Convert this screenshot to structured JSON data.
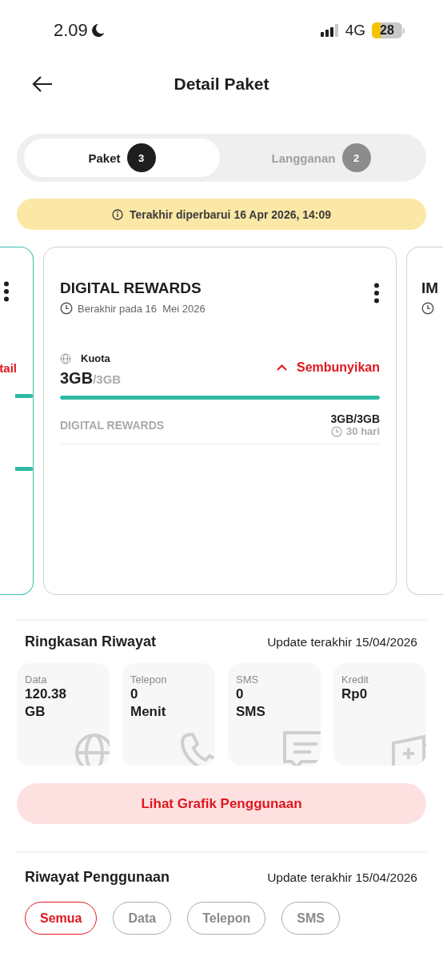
{
  "status_bar": {
    "time": "2.09",
    "network": "4G",
    "battery": "28"
  },
  "header": {
    "title": "Detail Paket"
  },
  "tabs": [
    {
      "label": "Paket",
      "count": "3",
      "selected": true
    },
    {
      "label": "Langganan",
      "count": "2",
      "selected": false
    }
  ],
  "notice": {
    "text": "Terakhir diperbarui 16 Apr 2026, 14:09"
  },
  "carousel": {
    "prev_card": {
      "action": "tail",
      "bars": [
        {
          "level": 1
        },
        {
          "level": 1
        }
      ]
    },
    "card": {
      "title": "DIGITAL REWARDS",
      "expiry": "Berakhir pada 16  Mei 2026",
      "quota_label": "Kuota",
      "used": "3GB",
      "total": "/3GB",
      "toggle": "Sembunyikan",
      "expanded": true,
      "level": 1,
      "items": [
        {
          "name": "DIGITAL REWARDS",
          "amount": "3GB/3GB",
          "duration": "30 hari"
        }
      ]
    },
    "next_card": {
      "title": "IM"
    }
  },
  "summary": {
    "title": "Ringkasan Riwayat",
    "updated": "Update terakhir 15/04/2026",
    "tiles": [
      {
        "kind": "data",
        "label": "Data",
        "value": "120.38\nGB"
      },
      {
        "kind": "call",
        "label": "Telepon",
        "value": "0\nMenit"
      },
      {
        "kind": "sms",
        "label": "SMS",
        "value": "0\nSMS"
      },
      {
        "kind": "credit",
        "label": "Kredit",
        "value": "Rp0"
      }
    ],
    "button": "Lihat Grafik Penggunaan"
  },
  "history": {
    "title": "Riwayat Penggunaan",
    "updated": "Update terakhir 15/04/2026",
    "filters": [
      {
        "label": "Semua",
        "selected": true
      },
      {
        "label": "Data",
        "selected": false
      },
      {
        "label": "Telepon",
        "selected": false
      },
      {
        "label": "SMS",
        "selected": false
      }
    ]
  }
}
